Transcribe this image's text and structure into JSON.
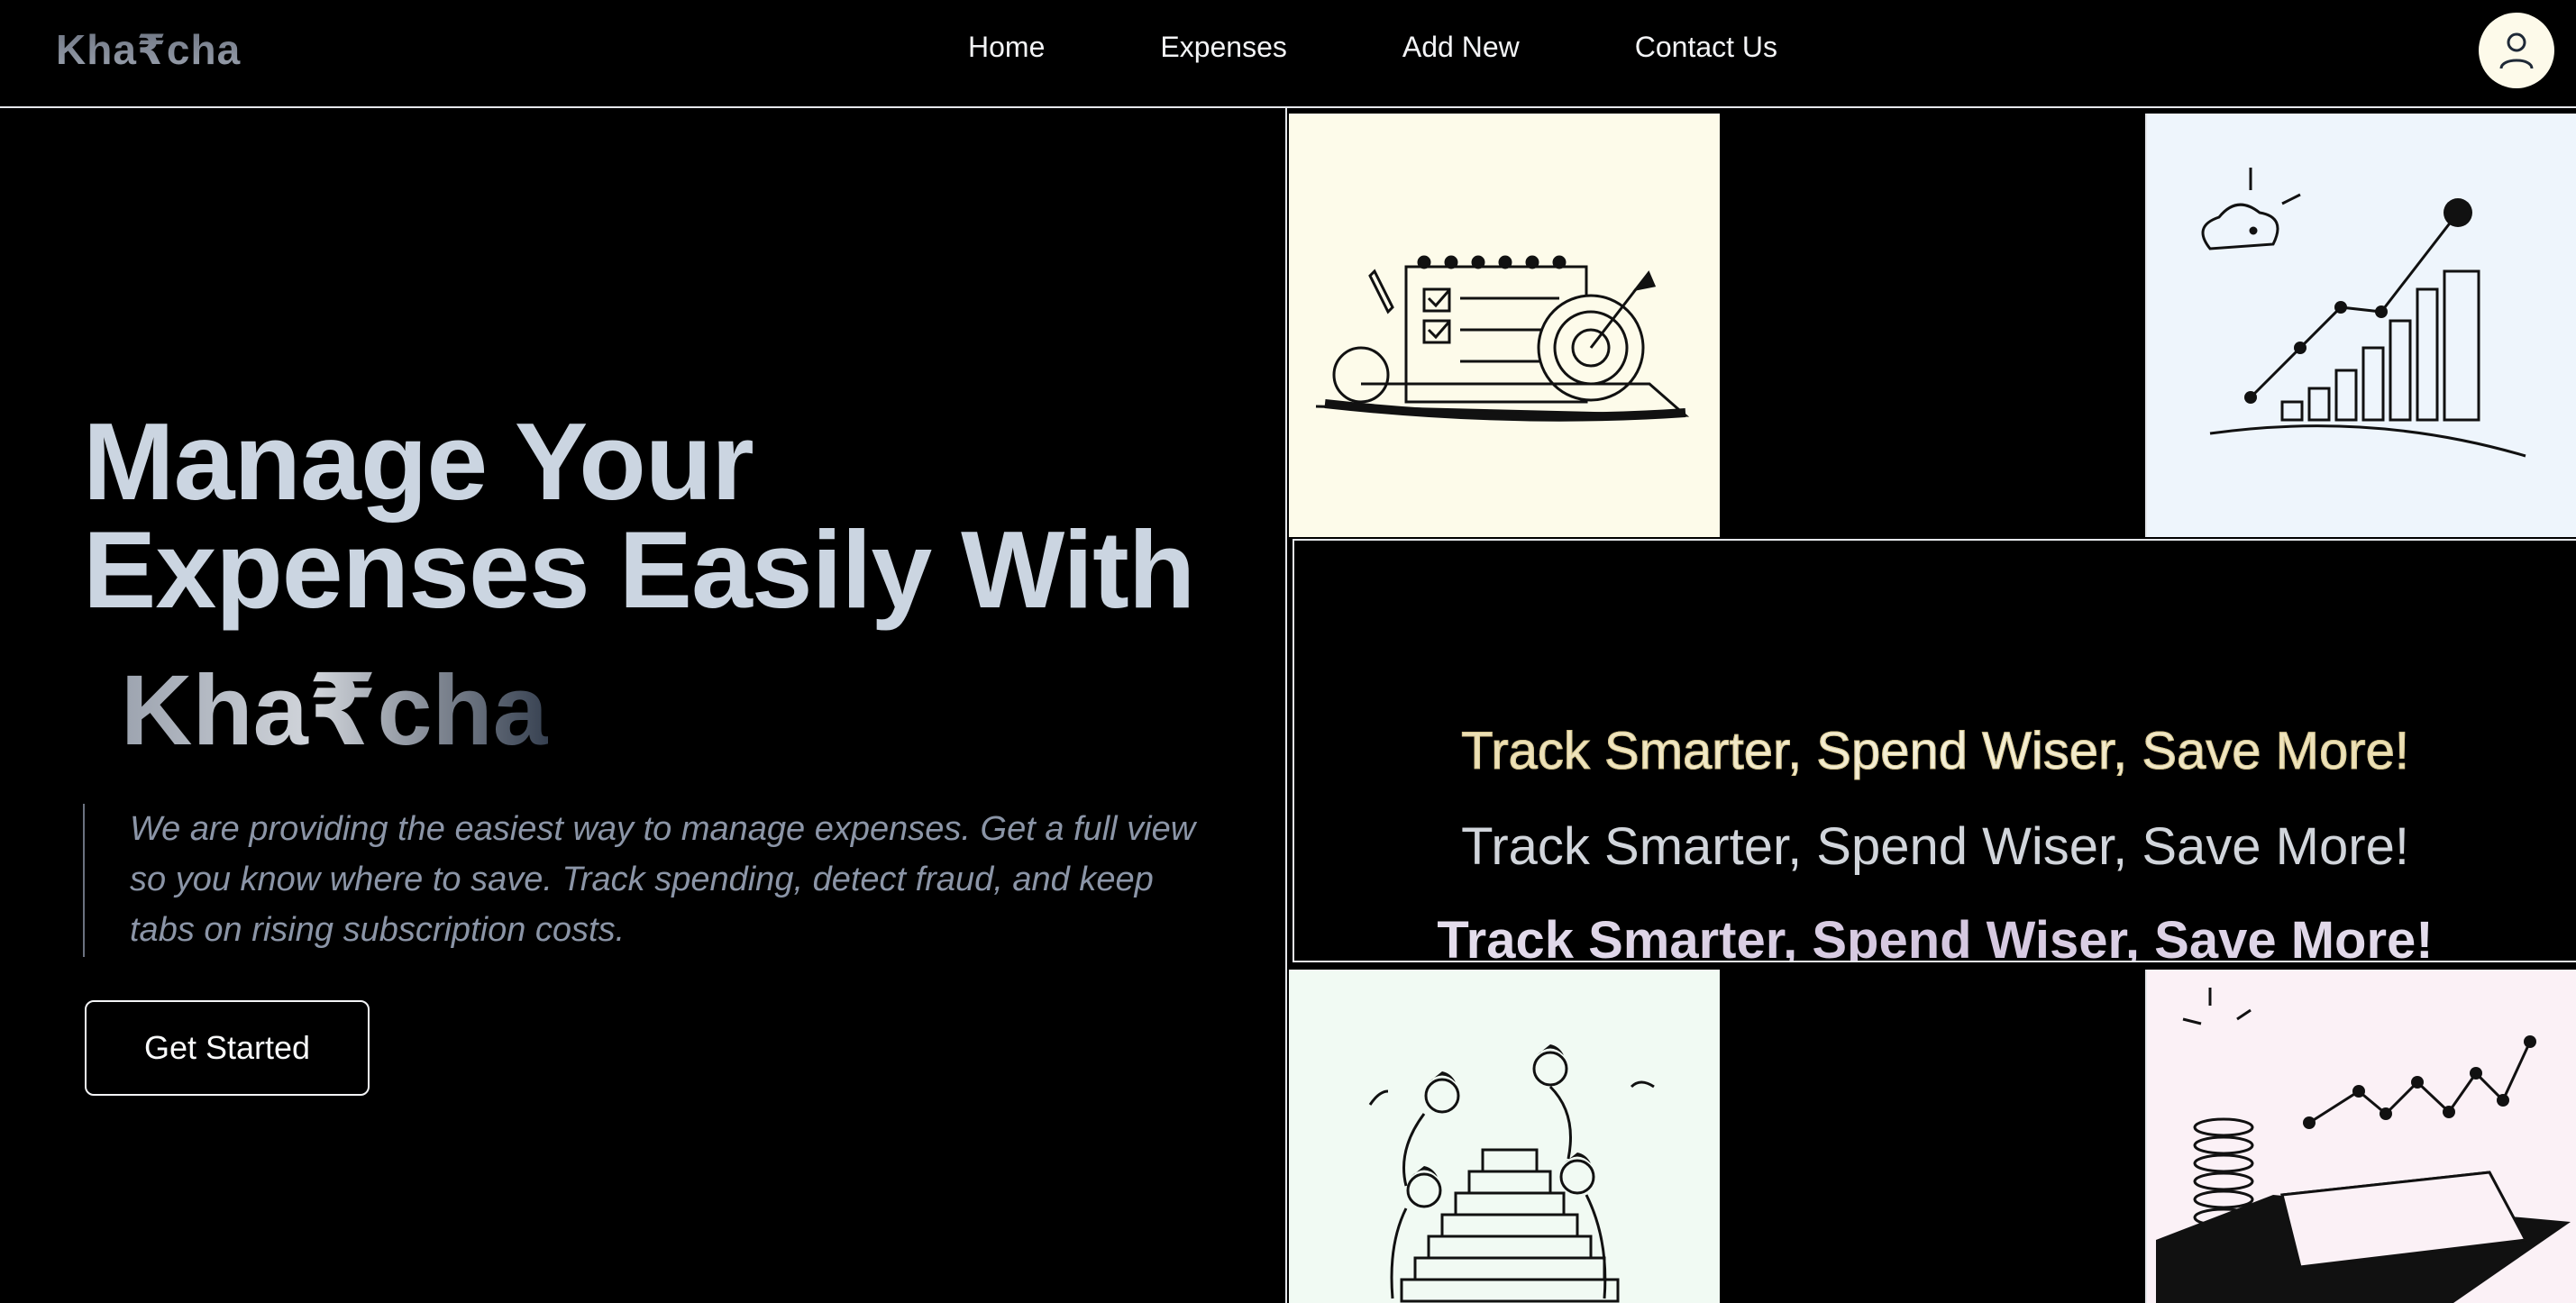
{
  "nav": {
    "logo": "Kha₹cha",
    "links": [
      "Home",
      "Expenses",
      "Add New",
      "Contact Us"
    ],
    "avatar_icon": "user-icon"
  },
  "hero": {
    "title_line1": "Manage Your",
    "title_line2": "Expenses Easily With",
    "brand": "Kha₹cha",
    "description": "We are providing the easiest way to manage expenses. Get a full view so you know where to save. Track spending, detect fraud, and keep tabs on rising subscription costs.",
    "cta_label": "Get Started"
  },
  "tagline": {
    "line1": "Track Smarter, Spend Wiser, Save More!",
    "line2": "Track Smarter, Spend Wiser, Save More!",
    "line3": "Track Smarter, Spend Wiser, Save More!"
  },
  "illustrations": [
    "planner-target-illustration",
    "growth-chart-illustration",
    "team-building-blocks-illustration",
    "coins-contract-illustration"
  ],
  "colors": {
    "background": "#000000",
    "title": "#cbd5e1",
    "avatar_bg": "#fdfaea"
  }
}
